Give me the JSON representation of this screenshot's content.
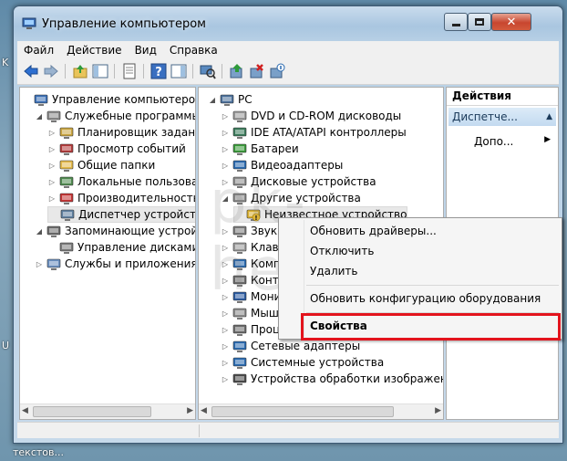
{
  "window": {
    "title": "Управление компьютером",
    "menu": [
      "Файл",
      "Действие",
      "Вид",
      "Справка"
    ]
  },
  "desktop": {
    "left_letters": [
      "K",
      "U"
    ],
    "bottom_text": "текстов..."
  },
  "left_tree": [
    {
      "label": "Управление компьютером (л",
      "icon": "computer-management-icon",
      "indent": 0,
      "arrow": ""
    },
    {
      "label": "Служебные программы",
      "icon": "tools-icon",
      "indent": 1,
      "arrow": "◢"
    },
    {
      "label": "Планировщик заданий",
      "icon": "clock-icon",
      "indent": 2,
      "arrow": "▷"
    },
    {
      "label": "Просмотр событий",
      "icon": "event-viewer-icon",
      "indent": 2,
      "arrow": "▷"
    },
    {
      "label": "Общие папки",
      "icon": "shared-folder-icon",
      "indent": 2,
      "arrow": "▷"
    },
    {
      "label": "Локальные пользовате",
      "icon": "users-icon",
      "indent": 2,
      "arrow": "▷"
    },
    {
      "label": "Производительность",
      "icon": "performance-icon",
      "indent": 2,
      "arrow": "▷"
    },
    {
      "label": "Диспетчер устройств",
      "icon": "device-manager-icon",
      "indent": 2,
      "arrow": "",
      "selected": true
    },
    {
      "label": "Запоминающие устройст",
      "icon": "storage-icon",
      "indent": 1,
      "arrow": "◢"
    },
    {
      "label": "Управление дисками",
      "icon": "disk-management-icon",
      "indent": 2,
      "arrow": ""
    },
    {
      "label": "Службы и приложения",
      "icon": "services-icon",
      "indent": 1,
      "arrow": "▷"
    }
  ],
  "device_tree": [
    {
      "label": "PC",
      "icon": "pc-icon",
      "indent": 0,
      "arrow": "◢"
    },
    {
      "label": "DVD и CD-ROM дисководы",
      "icon": "dvd-icon",
      "indent": 1,
      "arrow": "▷"
    },
    {
      "label": "IDE ATA/ATAPI контроллеры",
      "icon": "ide-icon",
      "indent": 1,
      "arrow": "▷"
    },
    {
      "label": "Батареи",
      "icon": "battery-icon",
      "indent": 1,
      "arrow": "▷"
    },
    {
      "label": "Видеоадаптеры",
      "icon": "display-adapter-icon",
      "indent": 1,
      "arrow": "▷"
    },
    {
      "label": "Дисковые устройства",
      "icon": "disk-drive-icon",
      "indent": 1,
      "arrow": "▷"
    },
    {
      "label": "Другие устройства",
      "icon": "other-devices-icon",
      "indent": 1,
      "arrow": "◢"
    },
    {
      "label": "Неизвестное устройство",
      "icon": "unknown-device-icon",
      "indent": 2,
      "arrow": "",
      "selected": true
    },
    {
      "label": "Звук",
      "icon": "sound-icon",
      "indent": 1,
      "arrow": "▷"
    },
    {
      "label": "Клав",
      "icon": "keyboard-icon",
      "indent": 1,
      "arrow": "▷"
    },
    {
      "label": "Комп",
      "icon": "computer-icon",
      "indent": 1,
      "arrow": "▷"
    },
    {
      "label": "Конт",
      "icon": "controller-icon",
      "indent": 1,
      "arrow": "▷"
    },
    {
      "label": "Мони",
      "icon": "monitor-icon",
      "indent": 1,
      "arrow": "▷"
    },
    {
      "label": "Мыш",
      "icon": "mouse-icon",
      "indent": 1,
      "arrow": "▷"
    },
    {
      "label": "Проц",
      "icon": "processor-icon",
      "indent": 1,
      "arrow": "▷"
    },
    {
      "label": "Сетевые адаптеры",
      "icon": "network-adapter-icon",
      "indent": 1,
      "arrow": "▷"
    },
    {
      "label": "Системные устройства",
      "icon": "system-devices-icon",
      "indent": 1,
      "arrow": "▷"
    },
    {
      "label": "Устройства обработки изображений",
      "icon": "imaging-devices-icon",
      "indent": 1,
      "arrow": "▷"
    }
  ],
  "actions": {
    "header": "Действия",
    "sub": "Диспетче...",
    "more": "Допо..."
  },
  "context_menu": {
    "update_drivers": "Обновить драйверы...",
    "disable": "Отключить",
    "delete": "Удалить",
    "scan": "Обновить конфигурацию оборудования",
    "properties": "Свойства"
  },
  "watermark": "pk-help.com"
}
